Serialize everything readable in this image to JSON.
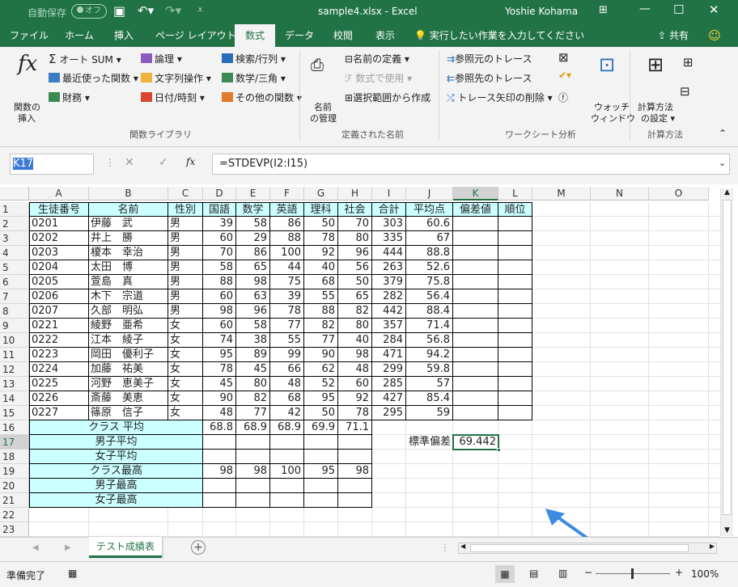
{
  "window": {
    "autosave": "自動保存",
    "autosave_state": "オフ",
    "filename": "sample4.xlsx  -  Excel",
    "user": "Yoshie Kohama"
  },
  "ribbon_tabs": [
    "ファイル",
    "ホーム",
    "挿入",
    "ページ レイアウト",
    "数式",
    "データ",
    "校閲",
    "表示"
  ],
  "tell_me": "実行したい作業を入力してください",
  "share": "共有",
  "ribbon": {
    "insert_fn_1": "関数の",
    "insert_fn_2": "挿入",
    "autosum": "オート SUM",
    "recent": "最近使った関数",
    "finance": "財務",
    "logic": "論理",
    "text": "文字列操作",
    "datetime": "日付/時刻",
    "lookup": "検索/行列",
    "math": "数学/三角",
    "more": "その他の関数",
    "g1": "関数ライブラリ",
    "define_name": "名前の定義",
    "use_in": "数式で使用",
    "name_mgr_1": "名前",
    "name_mgr_2": "の管理",
    "create_sel": "選択範囲から作成",
    "g2": "定義された名前",
    "trace_prec": "参照元のトレース",
    "trace_dep": "参照先のトレース",
    "remove_arrows": "トレース矢印の削除",
    "watch_1": "ウォッチ",
    "watch_2": "ウィンドウ",
    "g3": "ワークシート分析",
    "calc_1": "計算方法",
    "calc_2": "の設定",
    "g4": "計算方法"
  },
  "namebox": "K17",
  "formula": "=STDEVP(I2:I15)",
  "cols": [
    "A",
    "B",
    "C",
    "D",
    "E",
    "F",
    "G",
    "H",
    "I",
    "J",
    "K",
    "L",
    "M",
    "N",
    "O"
  ],
  "headers": [
    "生徒番号",
    "名前",
    "性別",
    "国語",
    "数学",
    "英語",
    "理科",
    "社会",
    "合計",
    "平均点",
    "偏差値",
    "順位"
  ],
  "students": [
    [
      "0201",
      "伊藤　武",
      "男",
      "39",
      "58",
      "86",
      "50",
      "70",
      "303",
      "60.6"
    ],
    [
      "0202",
      "井上　勝",
      "男",
      "60",
      "29",
      "88",
      "78",
      "80",
      "335",
      "67"
    ],
    [
      "0203",
      "榎本　幸治",
      "男",
      "70",
      "86",
      "100",
      "92",
      "96",
      "444",
      "88.8"
    ],
    [
      "0204",
      "太田　博",
      "男",
      "58",
      "65",
      "44",
      "40",
      "56",
      "263",
      "52.6"
    ],
    [
      "0205",
      "萱島　真",
      "男",
      "88",
      "98",
      "75",
      "68",
      "50",
      "379",
      "75.8"
    ],
    [
      "0206",
      "木下　宗道",
      "男",
      "60",
      "63",
      "39",
      "55",
      "65",
      "282",
      "56.4"
    ],
    [
      "0207",
      "久部　明弘",
      "男",
      "98",
      "96",
      "78",
      "88",
      "82",
      "442",
      "88.4"
    ],
    [
      "0221",
      "綾野　亜希",
      "女",
      "60",
      "58",
      "77",
      "82",
      "80",
      "357",
      "71.4"
    ],
    [
      "0222",
      "江本　綾子",
      "女",
      "74",
      "38",
      "55",
      "77",
      "40",
      "284",
      "56.8"
    ],
    [
      "0223",
      "岡田　優利子",
      "女",
      "95",
      "89",
      "99",
      "90",
      "98",
      "471",
      "94.2"
    ],
    [
      "0224",
      "加藤　祐美",
      "女",
      "78",
      "45",
      "66",
      "62",
      "48",
      "299",
      "59.8"
    ],
    [
      "0225",
      "河野　恵美子",
      "女",
      "45",
      "80",
      "48",
      "52",
      "60",
      "285",
      "57"
    ],
    [
      "0226",
      "斎藤　美恵",
      "女",
      "90",
      "82",
      "68",
      "95",
      "92",
      "427",
      "85.4"
    ],
    [
      "0227",
      "篠原　信子",
      "女",
      "48",
      "77",
      "42",
      "50",
      "78",
      "295",
      "59"
    ]
  ],
  "summary_labels": [
    "クラス 平均",
    "男子平均",
    "女子平均",
    "クラス最高",
    "男子最高",
    "女子最高"
  ],
  "class_avg": [
    "68.8",
    "68.9",
    "68.9",
    "69.9",
    "71.1"
  ],
  "class_max": [
    "98",
    "98",
    "100",
    "95",
    "98"
  ],
  "stddev_label": "標準偏差",
  "stddev_value": "69.442",
  "sheet_tab": "テスト成績表",
  "status": "準備完了",
  "zoom": "100%"
}
